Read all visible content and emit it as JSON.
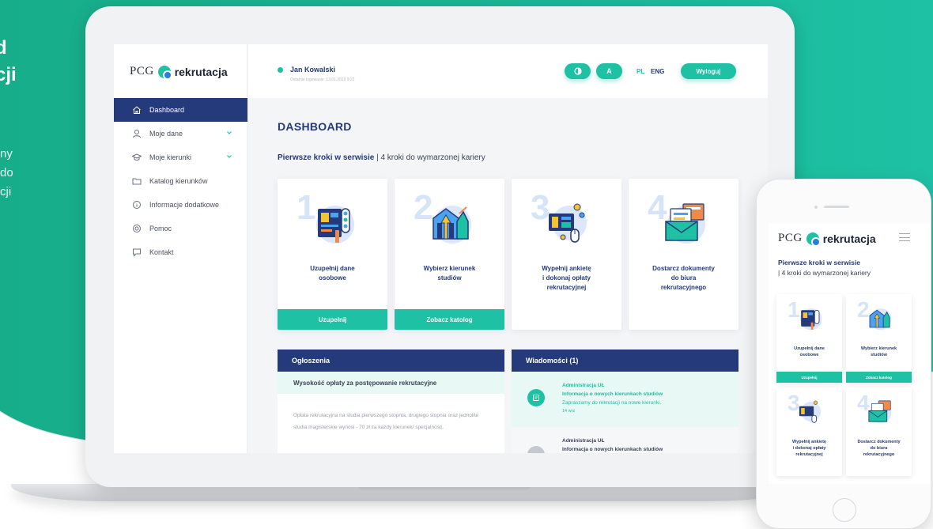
{
  "hero": {
    "heading": "d\ncji",
    "text": "ny do\ncji"
  },
  "sidebar": {
    "logo_pcg": "PCG",
    "logo_word": "rekrutacja",
    "items": [
      {
        "label": "Dashboard",
        "icon": "home-icon"
      },
      {
        "label": "Moje dane",
        "icon": "user-icon"
      },
      {
        "label": "Moje kierunki",
        "icon": "graduation-cap-icon"
      },
      {
        "label": "Katalog kierunków",
        "icon": "folder-icon"
      },
      {
        "label": "Informacje dodatkowe",
        "icon": "info-icon"
      },
      {
        "label": "Pomoc",
        "icon": "lifebuoy-icon"
      },
      {
        "label": "Kontakt",
        "icon": "chat-icon"
      }
    ]
  },
  "topbar": {
    "user_name": "Jan Kowalski",
    "last_login": "Ostatnie logowanie: 13.01.2019 9:22",
    "font_label": "A",
    "lang_pl": "PL",
    "lang_eng": "ENG",
    "logout_label": "Wyloguj"
  },
  "main": {
    "title": "DASHBOARD",
    "subtitle_bold": "Pierwsze kroki w serwisie",
    "subtitle_rest": " | 4 kroki do wymarzonej kariery",
    "cards": [
      {
        "num": "1",
        "title": "Uzupełnij dane\nosobowe",
        "button": "Uzupełnij"
      },
      {
        "num": "2",
        "title": "Wybierz kierunek\nstudiów",
        "button": "Zobacz katolog"
      },
      {
        "num": "3",
        "title": "Wypełnij ankietę\ni dokonaj opłaty\nrekrutacyjnej",
        "button": ""
      },
      {
        "num": "4",
        "title": "Dostarcz dokumenty\ndo biura\nrekrutacyjnego",
        "button": ""
      }
    ]
  },
  "announcements": {
    "header": "Ogłoszenia",
    "highlight": "Wysokość opłaty za postępowanie rekrutacyjne",
    "text": "Opłata rekrutacyjna na studia pierwszego stopnia, drugiego stopnia oraz jednolite studia magisterskie wynosi - 70 zł za każdy kierunek/ specjalność."
  },
  "messages": {
    "header": "Wiadomości (1)",
    "items": [
      {
        "from": "Administracja UŁ",
        "subject": "Informacja o nowych kierunkach studiów",
        "body": "Zapraszamy do rekrutacji na nowe kierunki.",
        "date": "14 wrz"
      },
      {
        "from": "Administracja UŁ",
        "subject": "Informacja o nowych kierunkach studiów"
      }
    ]
  },
  "mobile": {
    "logo_pcg": "PCG",
    "logo_word": "rekrutacja",
    "heading_bold": "Pierwsze kroki w serwisie",
    "heading_rest": "| 4 kroki do wymarzonej kariery",
    "cards": [
      {
        "num": "1",
        "title": "Uzupełnij dane\nosobowe",
        "button": "Uzupełnij"
      },
      {
        "num": "2",
        "title": "Wybierz kierunek\nstudiów",
        "button": "Zobacz katolog"
      },
      {
        "num": "3",
        "title": "Wypełnij ankietę\ni dokonaj opłaty\nrekrutacyjnej",
        "button": ""
      },
      {
        "num": "4",
        "title": "Dostarcz dokumenty\ndo biura\nrekrutacyjnego",
        "button": ""
      }
    ]
  },
  "colors": {
    "brand_green": "#1ec1a4",
    "navy": "#243a7a",
    "hero_bg": "#18b391"
  }
}
